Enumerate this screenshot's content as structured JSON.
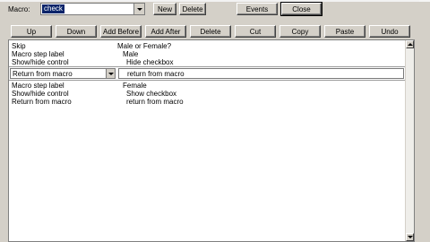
{
  "toolbar": {
    "macro_label": "Macro:",
    "macro_value": "check",
    "new_label": "New",
    "delete_label": "Delete",
    "events_label": "Events",
    "close_label": "Close"
  },
  "actions": {
    "up": "Up",
    "down": "Down",
    "add_before": "Add Before",
    "add_after": "Add After",
    "delete": "Delete",
    "cut": "Cut",
    "copy": "Copy",
    "paste": "Paste",
    "undo": "Undo"
  },
  "steps": [
    {
      "action": "Skip",
      "value": "Male or Female?"
    },
    {
      "action": "Macro step label",
      "value": "Male"
    },
    {
      "action": "Show/hide control",
      "value": "Hide checkbox"
    },
    {
      "action": "Return from macro",
      "value": "return from macro"
    },
    {
      "action": "Macro step label",
      "value": "Female"
    },
    {
      "action": "Show/hide control",
      "value": "Show checkbox"
    },
    {
      "action": "Return from macro",
      "value": "return from macro"
    }
  ]
}
